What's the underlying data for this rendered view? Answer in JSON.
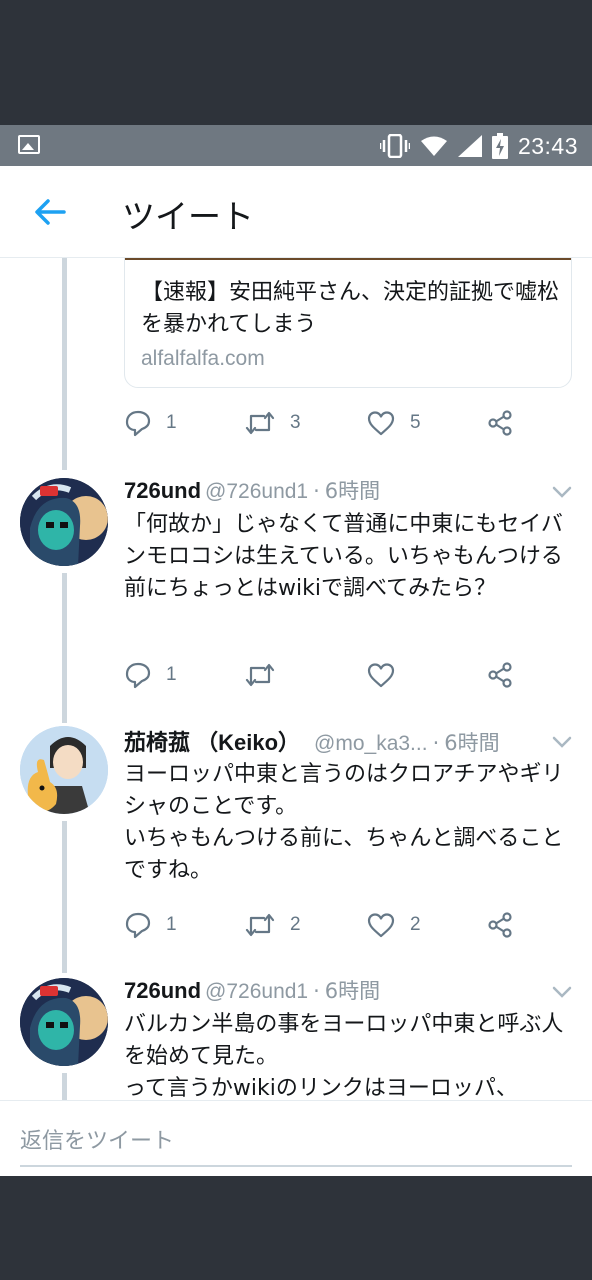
{
  "status_bar": {
    "time": "23:43"
  },
  "app_bar": {
    "title": "ツイート"
  },
  "link_card": {
    "title": "【速報】安田純平さん、決定的証拠で嘘松を暴かれてしまう",
    "domain": "alfalfalfa.com"
  },
  "top_actions": {
    "reply_count": "1",
    "retweet_count": "3",
    "like_count": "5"
  },
  "tweets": [
    {
      "name": "726und",
      "handle": "@726und1",
      "separator": "·",
      "time": "6時間",
      "text": "「何故か」じゃなくて普通に中東にもセイバンモロコシは生えている。いちゃもんつける前にちょっとはwikiで調べてみたら？",
      "reply_count": "1",
      "retweet_count": "",
      "like_count": ""
    },
    {
      "name": "茄椅菰 （Keiko）",
      "handle": "@mo_ka3...",
      "separator": "·",
      "time": "6時間",
      "text": "ヨーロッパ中東と言うのはクロアチアやギリシャのことです。\nいちゃもんつける前に、ちゃんと調べることですね。",
      "reply_count": "1",
      "retweet_count": "2",
      "like_count": "2"
    },
    {
      "name": "726und",
      "handle": "@726und1",
      "separator": "·",
      "time": "6時間",
      "text": "バルカン半島の事をヨーロッパ中東と呼ぶ人を始めて見た。\nって言うかwikiのリンクはヨーロッパ、"
    }
  ],
  "reply_bar": {
    "placeholder": "返信をツイート"
  },
  "colors": {
    "accent": "#1da1f2",
    "action_gray": "#657786",
    "status_bar": "#6f7881"
  },
  "icons": [
    "image-icon",
    "vibrate-icon",
    "wifi-icon",
    "signal-icon",
    "battery-icon",
    "back-arrow-icon",
    "reply-icon",
    "retweet-icon",
    "like-icon",
    "share-icon",
    "chevron-down-icon"
  ]
}
